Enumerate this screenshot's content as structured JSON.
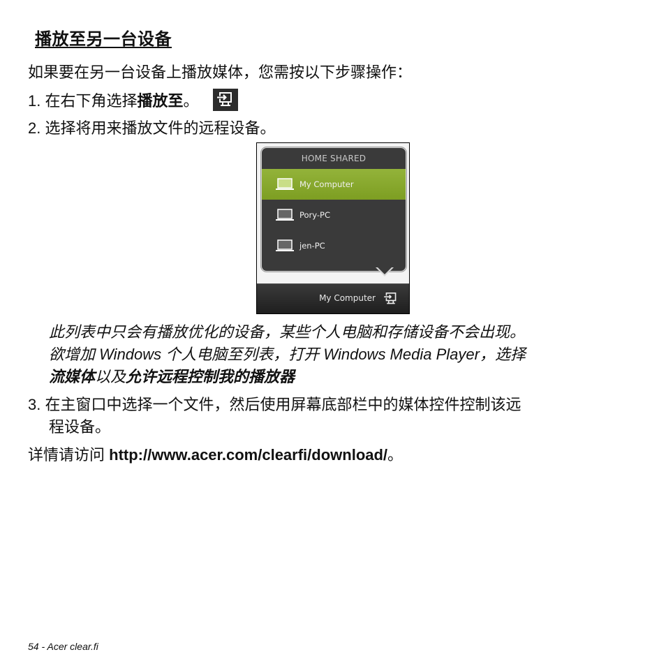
{
  "section_title": "播放至另一台设备",
  "intro": "如果要在另一台设备上播放媒体，您需按以下步骤操作：",
  "steps": [
    {
      "number": "1.",
      "text_before": "在右下角选择",
      "bold": "播放至",
      "text_after": "。",
      "icon": "play-to-icon"
    },
    {
      "number": "2.",
      "text": "选择将用来播放文件的远程设备。"
    },
    {
      "number": "3.",
      "text_line1": "在主窗口中选择一个文件，然后使用屏幕底部栏中的媒体控件控制该远",
      "text_line2": "程设备。"
    }
  ],
  "popup": {
    "header": "HOME SHARED",
    "devices": [
      {
        "name": "My Computer",
        "selected": true,
        "icon": "laptop-icon"
      },
      {
        "name": "Pory-PC",
        "selected": false,
        "icon": "laptop-icon"
      },
      {
        "name": "jen-PC",
        "selected": false,
        "icon": "laptop-icon"
      }
    ],
    "taskbar_label": "My Computer",
    "taskbar_icon": "play-to-icon",
    "accent_color": "#8aab2e"
  },
  "note": {
    "line1": "此列表中只会有播放优化的设备，某些个人电脑和存储设备不会出现。",
    "line2": "欲增加 Windows 个人电脑至列表，打开 Windows Media Player，选择",
    "line3_bold1": "流媒体",
    "line3_mid": "以及",
    "line3_bold2": "允许远程控制我的播放器"
  },
  "more_info": {
    "prefix": "详情请访问 ",
    "url": "http://www.acer.com/clearfi/download/",
    "suffix": "。"
  },
  "footer": "54 - Acer clear.fi"
}
